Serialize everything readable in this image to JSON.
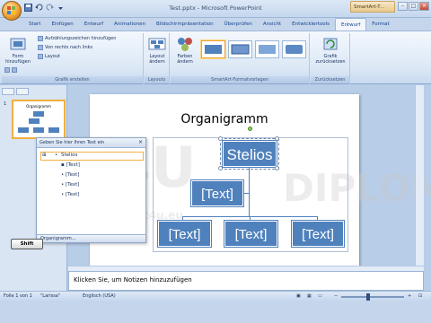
{
  "window": {
    "title": "Test.pptx - Microsoft PowerPoint",
    "context_tab": "SmartArt-T..."
  },
  "tabs": [
    {
      "label": "Start",
      "active": false
    },
    {
      "label": "Einfügen",
      "active": false
    },
    {
      "label": "Entwurf",
      "active": false
    },
    {
      "label": "Animationen",
      "active": false
    },
    {
      "label": "Bildschirmpräsentation",
      "active": false
    },
    {
      "label": "Überprüfen",
      "active": false
    },
    {
      "label": "Ansicht",
      "active": false
    },
    {
      "label": "Entwicklertools",
      "active": false
    },
    {
      "label": "Entwurf",
      "active": true
    },
    {
      "label": "Format",
      "active": false
    }
  ],
  "ribbon": {
    "groups": {
      "create_graphic": "Grafik erstellen",
      "layouts": "Layouts",
      "smartart_styles": "SmartArt-Formatvorlagen",
      "reset": "Zurücksetzen"
    },
    "add_shape_label": "Form\nhinzufügen",
    "add_bullet_label": "Aufzählungszeichen hinzufügen",
    "right_to_left_label": "Von rechts nach links",
    "layout_label": "Layout",
    "change_layout_label": "Layout\nändern",
    "change_colors_label": "Farben\nändern",
    "reset_graphic_label": "Grafik\nzurücksetzen"
  },
  "slide": {
    "title": "Organigramm",
    "nodes": {
      "top": "Stelios",
      "assistant": "[Text]",
      "child1": "[Text]",
      "child2": "[Text]",
      "child3": "[Text]"
    },
    "watermark_site": "www.test4u.eu",
    "watermark_diploma": "DIPLOMA",
    "watermark_brand": "4U"
  },
  "thumbnail": {
    "number": "1",
    "title": "Organigramm"
  },
  "text_pane": {
    "header": "Geben Sie hier Ihren Text ein",
    "items": [
      "Stelios",
      "[Text]",
      "[Text]",
      "[Text]",
      "[Text]"
    ],
    "footer": "Organigramm..."
  },
  "overlay_key": "Shift",
  "notes_placeholder": "Klicken Sie, um Notizen hinzuzufügen",
  "status": {
    "slide_info": "Folie 1 von 1",
    "theme": "\"Larissa\"",
    "language": "Englisch (USA)"
  },
  "colors": {
    "smartart_fill": "#4f81bd",
    "accent_orange": "#f0b040"
  }
}
